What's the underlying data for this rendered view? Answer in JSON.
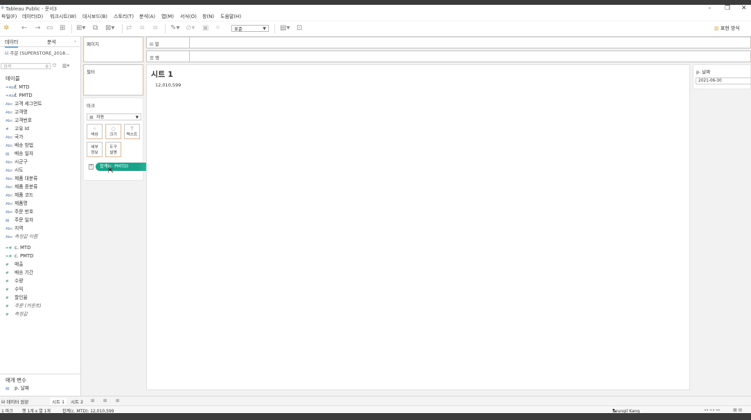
{
  "window": {
    "title": "Tableau Public - 문서3"
  },
  "menu": [
    "파일(F)",
    "데이터(D)",
    "워크시트(W)",
    "대시보드(B)",
    "스토리(T)",
    "분석(A)",
    "맵(M)",
    "서식(O)",
    "창(N)",
    "도움말(H)"
  ],
  "toolbar": {
    "fit_value": "표준",
    "show_me": "표현 방식"
  },
  "data_pane": {
    "tab_data": "데이터",
    "tab_analytics": "분석",
    "datasource": "주문 (SUPERSTORE_2018...",
    "search_placeholder": "검색",
    "tables_header": "테이블",
    "fields": [
      {
        "type": "=Abc",
        "name": "f. MTD"
      },
      {
        "type": "=Abc",
        "name": "f. PMTD"
      },
      {
        "type": "Abc",
        "name": "고객 세그먼트"
      },
      {
        "type": "Abc",
        "name": "고객명"
      },
      {
        "type": "Abc",
        "name": "고객번호"
      },
      {
        "type": "#",
        "name": "고유 Id"
      },
      {
        "type": "Abc",
        "name": "국가"
      },
      {
        "type": "Abc",
        "name": "배송 방법"
      },
      {
        "type": "▤",
        "name": "배송 일자"
      },
      {
        "type": "Abc",
        "name": "시군구"
      },
      {
        "type": "Abc",
        "name": "시도"
      },
      {
        "type": "Abc",
        "name": "제품 대분류"
      },
      {
        "type": "Abc",
        "name": "제품 중분류"
      },
      {
        "type": "Abc",
        "name": "제품 코드"
      },
      {
        "type": "Abc",
        "name": "제품명"
      },
      {
        "type": "Abc",
        "name": "주문 번호"
      },
      {
        "type": "▤",
        "name": "주문 일자"
      },
      {
        "type": "Abc",
        "name": "지역"
      },
      {
        "type": "Abc",
        "name": "측정값 이름",
        "italic": true
      },
      {
        "type": "=#",
        "name": "c. MTD",
        "measure": true
      },
      {
        "type": "=#",
        "name": "c. PMTD",
        "measure": true
      },
      {
        "type": "#",
        "name": "매출",
        "measure": true
      },
      {
        "type": "#",
        "name": "배송 기간",
        "measure": true
      },
      {
        "type": "#",
        "name": "수량",
        "measure": true
      },
      {
        "type": "#",
        "name": "수익",
        "measure": true
      },
      {
        "type": "#",
        "name": "할인율",
        "measure": true
      },
      {
        "type": "#",
        "name": "주문 (카운트)",
        "measure": true,
        "italic": true
      },
      {
        "type": "#",
        "name": "측정값",
        "measure": true,
        "italic": true
      }
    ],
    "params_header": "매개 변수",
    "param_field": "p. 날짜"
  },
  "cards": {
    "pages": "페이지",
    "filters": "필터",
    "marks": "마크",
    "mark_type": "자동",
    "mark_buttons": {
      "color": "색상",
      "size": "크기",
      "text": "텍스트",
      "detail": "세부\n정보",
      "tooltip": "도구\n설명"
    }
  },
  "drag_pill": "합계(c. PMTD)",
  "shelves": {
    "columns": "열",
    "rows": "행"
  },
  "view": {
    "sheet_title": "시트 1",
    "value": "12,010,599"
  },
  "parameter_control": {
    "title": "p. 날짜",
    "value": "2021-06-30"
  },
  "sheet_tabs": {
    "datasource": "데이터 원본",
    "sheets": [
      "시트 1",
      "시트 2"
    ]
  },
  "status": {
    "marks": "1 마크",
    "rows_cols": "행 1개 x 열 1개",
    "sum": "합계(c. MTD): 12,010,599",
    "user": "Seungil Kang"
  }
}
